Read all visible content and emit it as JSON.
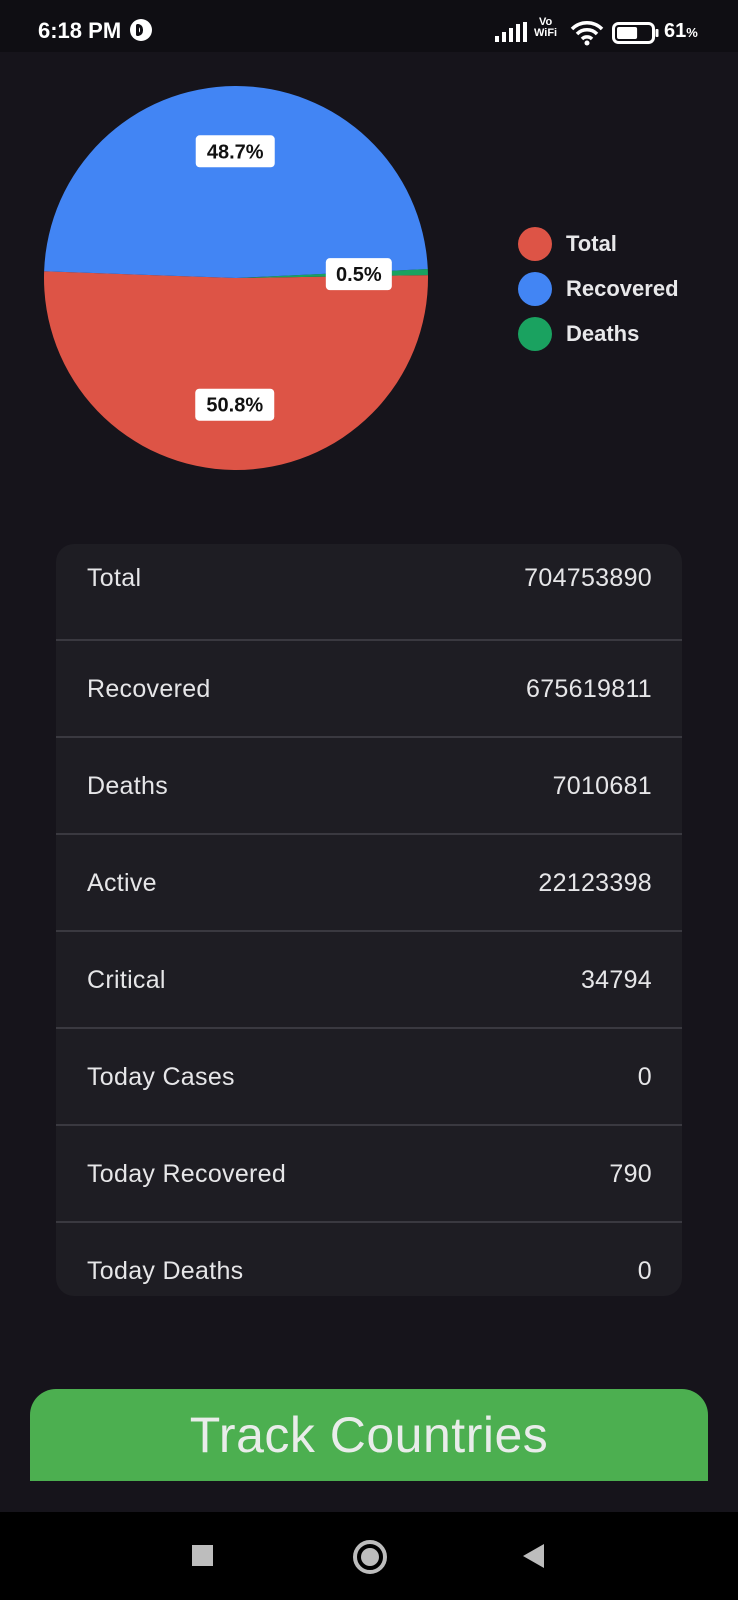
{
  "status_bar": {
    "time": "6:18 PM",
    "network_label_top": "Vo",
    "network_label_bottom": "WiFi",
    "battery_percent": "61",
    "battery_unit": "%",
    "battery_level": 0.61
  },
  "chart_data": {
    "type": "pie",
    "slices": [
      {
        "label": "Total",
        "value": 704753890,
        "percent_label": "50.8%",
        "color": "#dd5446"
      },
      {
        "label": "Recovered",
        "value": 675619811,
        "percent_label": "48.7%",
        "color": "#4285f4"
      },
      {
        "label": "Deaths",
        "value": 7010681,
        "percent_label": "0.5%",
        "color": "#1aa260"
      }
    ],
    "legend_position": "right"
  },
  "stats": [
    {
      "label": "Total",
      "value": "704753890"
    },
    {
      "label": "Recovered",
      "value": "675619811"
    },
    {
      "label": "Deaths",
      "value": "7010681"
    },
    {
      "label": "Active",
      "value": "22123398"
    },
    {
      "label": "Critical",
      "value": "34794"
    },
    {
      "label": "Today Cases",
      "value": "0"
    },
    {
      "label": "Today Recovered",
      "value": "790"
    },
    {
      "label": "Today Deaths",
      "value": "0"
    }
  ],
  "track_button_label": "Track Countries",
  "nav_bar": {
    "icons": [
      "recents-icon",
      "home-icon",
      "back-icon"
    ]
  }
}
